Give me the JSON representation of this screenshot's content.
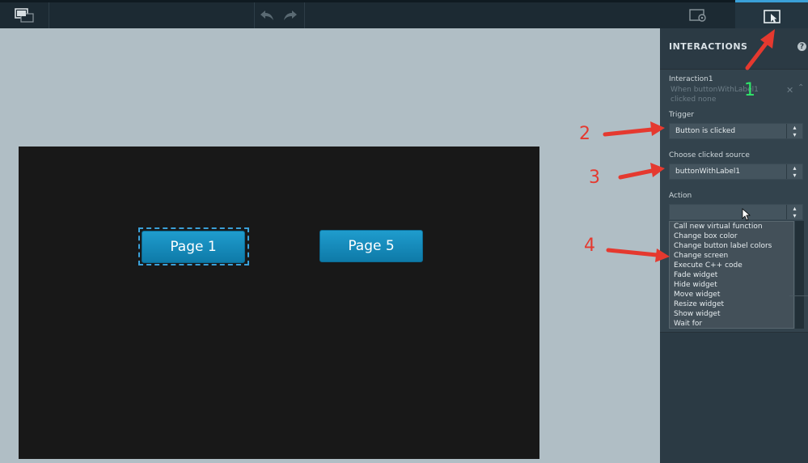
{
  "toolbar": {
    "left_icon": "screen-layers-icon",
    "undo_icon": "undo-icon",
    "redo_icon": "redo-icon",
    "screen_settings_icon": "screen-settings-icon",
    "interactions_icon": "interactions-cursor-icon"
  },
  "canvas": {
    "buttons": [
      {
        "label": "Page 1",
        "selected": true
      },
      {
        "label": "Page 5",
        "selected": false
      }
    ]
  },
  "panel": {
    "title": "INTERACTIONS",
    "help": "?",
    "interaction": {
      "name": "Interaction1",
      "summary_line1": "When buttonWithLabel1",
      "summary_line2": "clicked none"
    },
    "trigger": {
      "label": "Trigger",
      "value": "Button is clicked"
    },
    "source": {
      "label": "Choose clicked source",
      "value": "buttonWithLabel1"
    },
    "action": {
      "label": "Action",
      "value": "",
      "options": [
        "Call new virtual function",
        "Change box color",
        "Change button label colors",
        "Change screen",
        "Execute C++ code",
        "Fade widget",
        "Hide widget",
        "Move widget",
        "Resize widget",
        "Show widget",
        "Wait for"
      ]
    }
  },
  "annotations": {
    "n1": "1",
    "n2": "2",
    "n3": "3",
    "n4": "4",
    "arrow_color": "#e5392f",
    "highlight_color": "#2ee86a"
  },
  "colors": {
    "accent": "#3aa0d8",
    "button": "#1f9ccd",
    "panel": "#2b3a44",
    "canvas_bg": "#b0bec5",
    "screen_bg": "#181818"
  }
}
